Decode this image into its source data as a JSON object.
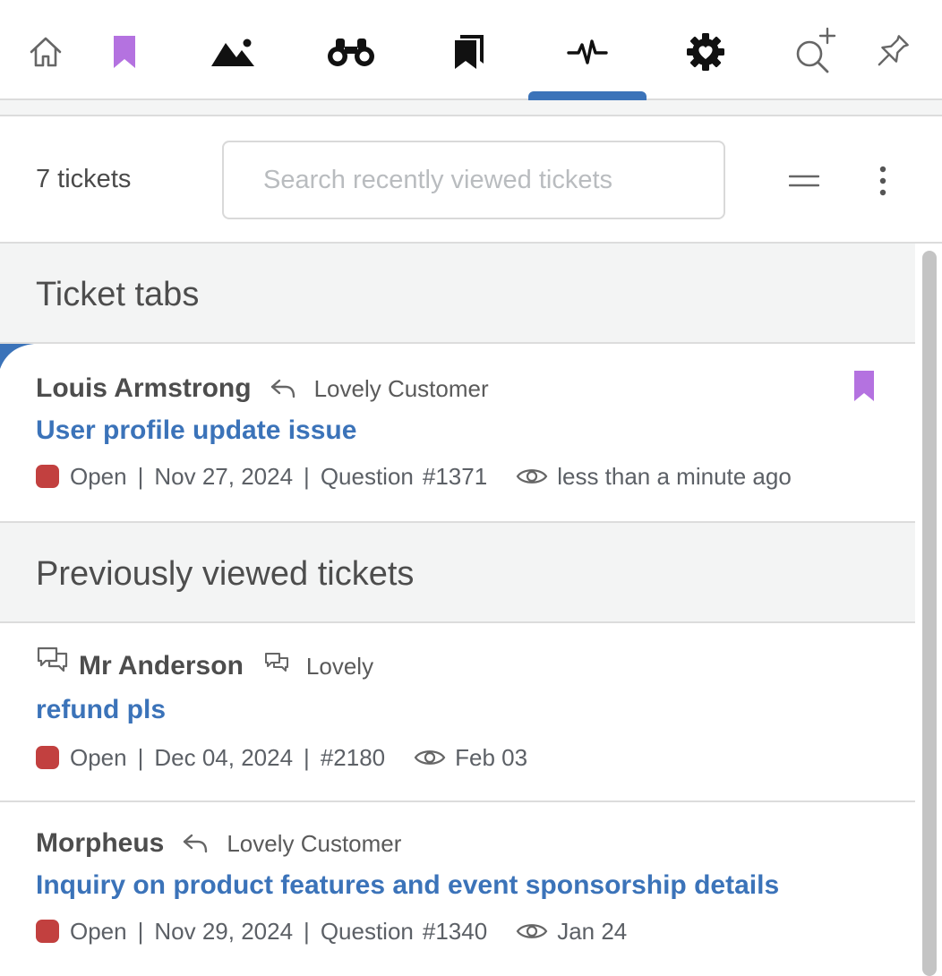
{
  "nav": {
    "items": [
      {
        "icon": "home-icon"
      },
      {
        "icon": "bookmark-icon",
        "color": "#b472e0"
      },
      {
        "icon": "mountain-image-icon"
      },
      {
        "icon": "binoculars-icon"
      },
      {
        "icon": "bookmarks-icon"
      },
      {
        "icon": "activity-pulse-icon",
        "active": true
      },
      {
        "icon": "gear-heart-icon"
      },
      {
        "icon": "search-plus-icon"
      },
      {
        "icon": "pin-icon"
      }
    ],
    "accent_color": "#3b73b9"
  },
  "toolbar": {
    "ticket_count": "7 tickets",
    "search_placeholder": "Search recently viewed tickets",
    "search_value": ""
  },
  "sections": {
    "ticket_tabs_title": "Ticket tabs",
    "previous_title": "Previously viewed tickets"
  },
  "tickets": [
    {
      "customer": "Louis Armstrong",
      "channel_icon": "reply-icon",
      "organization": "Lovely Customer",
      "subject": "User profile update issue",
      "status": "Open",
      "status_color": "#c2403f",
      "date": "Nov 27, 2024",
      "type": "Question",
      "number": "#1371",
      "viewed": "less than a minute ago",
      "bookmarked": true
    },
    {
      "customer": "Mr Anderson",
      "leading_icon": "chat-bubbles-icon",
      "channel_icon": "chat-bubbles-small-icon",
      "organization": "Lovely",
      "subject": "refund pls",
      "status": "Open",
      "status_color": "#c2403f",
      "date": "Dec 04, 2024",
      "number": "#2180",
      "viewed": "Feb 03"
    },
    {
      "customer": "Morpheus",
      "channel_icon": "reply-icon",
      "organization": "Lovely Customer",
      "subject": "Inquiry on product features and event sponsorship details",
      "status": "Open",
      "status_color": "#c2403f",
      "date": "Nov 29, 2024",
      "type": "Question",
      "number": "#1340",
      "viewed": "Jan 24"
    }
  ],
  "separator": "|"
}
